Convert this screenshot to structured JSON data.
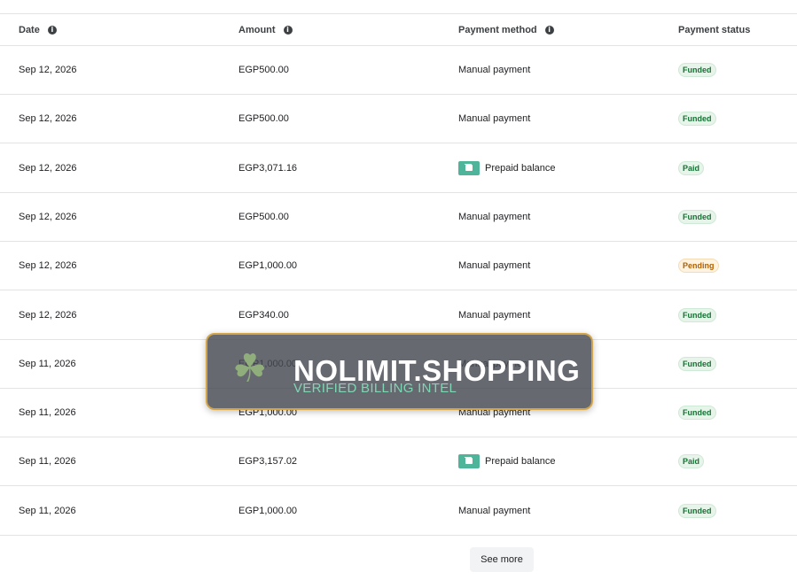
{
  "table": {
    "headers": {
      "date": "Date",
      "amount": "Amount",
      "payment_method": "Payment method",
      "payment_status": "Payment status"
    },
    "rows": [
      {
        "date": "Sep 12, 2026",
        "amount": "EGP500.00",
        "method": "Manual payment",
        "method_icon": "",
        "status": "Funded",
        "status_type": "funded"
      },
      {
        "date": "Sep 12, 2026",
        "amount": "EGP500.00",
        "method": "Manual payment",
        "method_icon": "",
        "status": "Funded",
        "status_type": "funded"
      },
      {
        "date": "Sep 12, 2026",
        "amount": "EGP3,071.16",
        "method": "Prepaid balance",
        "method_icon": "wallet-icon",
        "status": "Paid",
        "status_type": "paid"
      },
      {
        "date": "Sep 12, 2026",
        "amount": "EGP500.00",
        "method": "Manual payment",
        "method_icon": "",
        "status": "Funded",
        "status_type": "funded"
      },
      {
        "date": "Sep 12, 2026",
        "amount": "EGP1,000.00",
        "method": "Manual payment",
        "method_icon": "",
        "status": "Pending",
        "status_type": "pending"
      },
      {
        "date": "Sep 12, 2026",
        "amount": "EGP340.00",
        "method": "Manual payment",
        "method_icon": "",
        "status": "Funded",
        "status_type": "funded"
      },
      {
        "date": "Sep 11, 2026",
        "amount": "EGP1,000.00",
        "method": "Manual payment",
        "method_icon": "",
        "status": "Funded",
        "status_type": "funded"
      },
      {
        "date": "Sep 11, 2026",
        "amount": "EGP1,000.00",
        "method": "Manual payment",
        "method_icon": "",
        "status": "Funded",
        "status_type": "funded"
      },
      {
        "date": "Sep 11, 2026",
        "amount": "EGP3,157.02",
        "method": "Prepaid balance",
        "method_icon": "wallet-icon",
        "status": "Paid",
        "status_type": "paid"
      },
      {
        "date": "Sep 11, 2026",
        "amount": "EGP1,000.00",
        "method": "Manual payment",
        "method_icon": "",
        "status": "Funded",
        "status_type": "funded"
      }
    ]
  },
  "see_more_label": "See more",
  "overlay": {
    "brand": "NOLIMIT.SHOPPING",
    "tagline": "VERIFIED BILLING INTEL",
    "icon": "clover-icon"
  },
  "colors": {
    "funded": "#137333",
    "pending": "#b06000",
    "wallet": "#4fb59a",
    "overlay_border": "#d2a54a"
  }
}
